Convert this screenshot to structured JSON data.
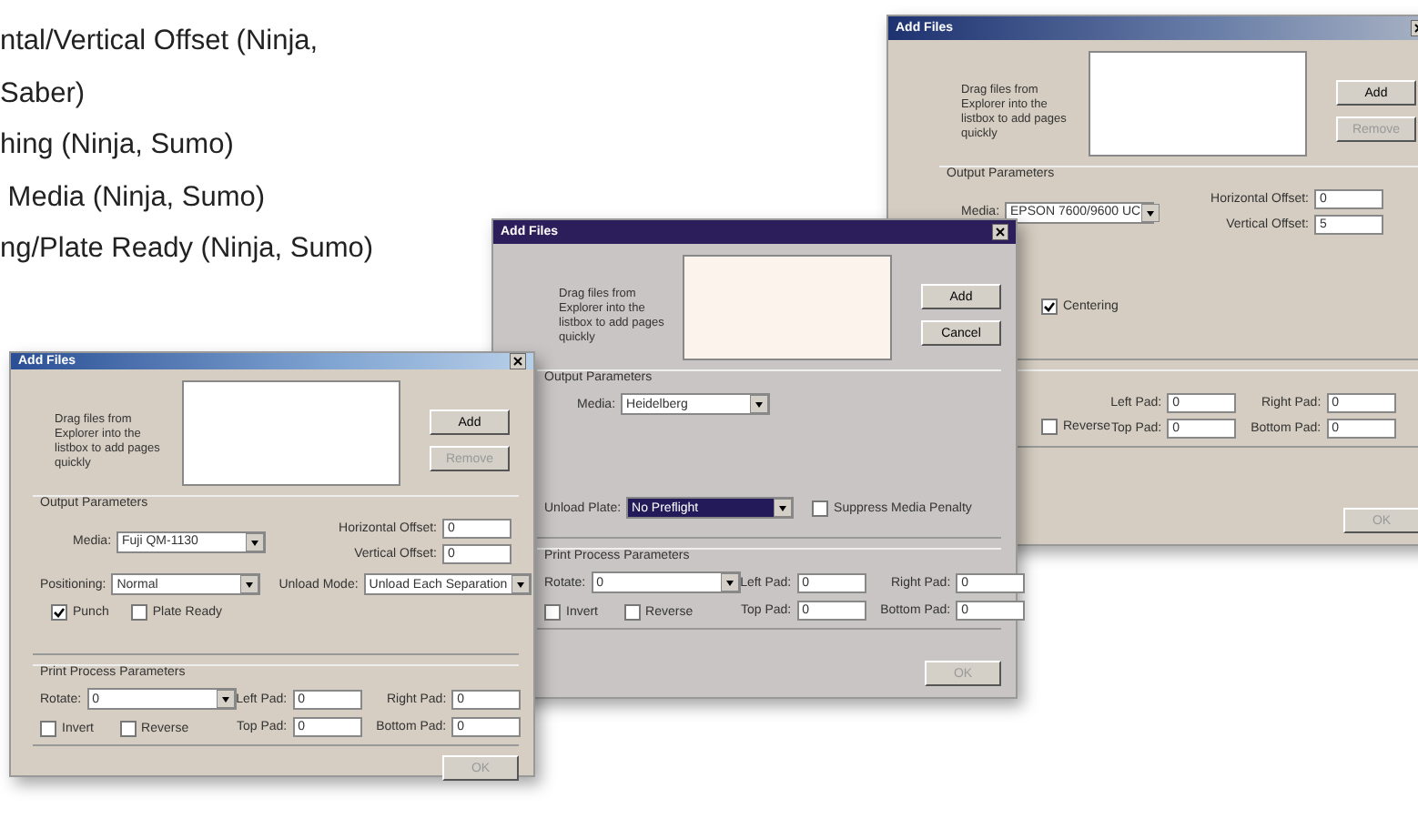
{
  "side_text": [
    "ntal/Vertical Offset (Ninja,",
    "Saber)",
    "hing (Ninja, Sumo)",
    " Media (Ninja, Sumo)",
    "ng/Plate Ready (Ninja, Sumo)"
  ],
  "windows": [
    {
      "title": "Add Files",
      "hint": "Drag files from Explorer into the listbox to add pages quickly",
      "buttons": [
        {
          "label": "Add",
          "disabled": false
        },
        {
          "label": "Remove",
          "disabled": true
        }
      ],
      "output_label": "Output Parameters",
      "media": {
        "label": "Media:",
        "value": "EPSON 7600/9600 UC"
      },
      "offsets": [
        {
          "label": "Horizontal Offset:",
          "value": "0"
        },
        {
          "label": "Vertical Offset:",
          "value": "5"
        }
      ],
      "checkboxes": [
        {
          "label": "Centering",
          "checked": true
        }
      ],
      "process_checkboxes": [
        {
          "label": "Reverse",
          "checked": false
        }
      ],
      "pads": [
        {
          "label": "Left Pad:",
          "value": "0"
        },
        {
          "label": "Right Pad:",
          "value": "0"
        },
        {
          "label": "Top Pad:",
          "value": "0"
        },
        {
          "label": "Bottom Pad:",
          "value": "0"
        }
      ],
      "ok": {
        "label": "OK",
        "disabled": true
      }
    },
    {
      "title": "Add Files",
      "hint": "Drag files from Explorer into the listbox to add pages quickly",
      "buttons": [
        {
          "label": "Add",
          "disabled": false
        },
        {
          "label": "Cancel",
          "disabled": false
        }
      ],
      "output_label": "Output Parameters",
      "media": {
        "label": "Media:",
        "value": "Heidelberg"
      },
      "unload": {
        "label": "Unload Plate:",
        "value": "No Preflight",
        "highlighted": true
      },
      "checkboxes": [
        {
          "label": "Suppress Media Penalty",
          "checked": false
        }
      ],
      "process_label": "Print Process Parameters",
      "rotate": {
        "label": "Rotate:",
        "value": "0"
      },
      "process_checkboxes": [
        {
          "label": "Invert",
          "checked": false
        },
        {
          "label": "Reverse",
          "checked": false
        }
      ],
      "pads": [
        {
          "label": "Left Pad:",
          "value": "0"
        },
        {
          "label": "Right Pad:",
          "value": "0"
        },
        {
          "label": "Top Pad:",
          "value": "0"
        },
        {
          "label": "Bottom Pad:",
          "value": "0"
        }
      ],
      "ok": {
        "label": "OK",
        "disabled": true
      }
    },
    {
      "title": "Add Files",
      "hint": "Drag files from Explorer into the listbox to add pages quickly",
      "buttons": [
        {
          "label": "Add",
          "disabled": false
        },
        {
          "label": "Remove",
          "disabled": true
        }
      ],
      "output_label": "Output Parameters",
      "media": {
        "label": "Media:",
        "value": "Fuji QM-1130"
      },
      "offsets": [
        {
          "label": "Horizontal Offset:",
          "value": "0"
        },
        {
          "label": "Vertical Offset:",
          "value": "0"
        }
      ],
      "positioning": {
        "label": "Positioning:",
        "value": "Normal"
      },
      "unload": {
        "label": "Unload Mode:",
        "value": "Unload Each Separation",
        "highlighted": false
      },
      "checkboxes": [
        {
          "label": "Punch",
          "checked": true
        },
        {
          "label": "Plate Ready",
          "checked": false
        }
      ],
      "process_label": "Print Process Parameters",
      "rotate": {
        "label": "Rotate:",
        "value": "0"
      },
      "process_checkboxes": [
        {
          "label": "Invert",
          "checked": false
        },
        {
          "label": "Reverse",
          "checked": false
        }
      ],
      "pads": [
        {
          "label": "Left Pad:",
          "value": "0"
        },
        {
          "label": "Right Pad:",
          "value": "0"
        },
        {
          "label": "Top Pad:",
          "value": "0"
        },
        {
          "label": "Bottom Pad:",
          "value": "0"
        }
      ],
      "ok": {
        "label": "OK",
        "disabled": true
      }
    }
  ]
}
